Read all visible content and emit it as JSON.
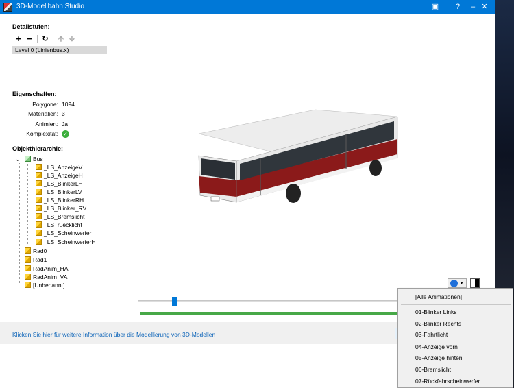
{
  "window": {
    "title": "3D-Modellbahn Studio",
    "controls": [
      "restore-icon",
      "help",
      "minimize",
      "close"
    ]
  },
  "detail": {
    "header": "Detailstufen:",
    "lod_items": [
      "Level 0 (Linienbus.x)"
    ]
  },
  "properties": {
    "header": "Eigenschaften:",
    "rows": [
      {
        "label": "Polygone:",
        "value": "1094"
      },
      {
        "label": "Materialien:",
        "value": "3"
      },
      {
        "label": "Animiert:",
        "value": "Ja"
      },
      {
        "label": "Komplexität:",
        "value": "ok-icon"
      }
    ]
  },
  "hierarchy": {
    "header": "Objekthierarchie:",
    "root": "Bus",
    "children": [
      "_LS_AnzeigeV",
      "_LS_AnzeigeH",
      "_LS_BlinkerLH",
      "_LS_BlinkerLV",
      "_LS_BlinkerRH",
      "_LS_Blinker_RV",
      "_LS_Bremslicht",
      "_LS_ruecklicht",
      "_LS_Scheinwerfer",
      "_LS_ScheinwerferH"
    ],
    "siblings": [
      "Rad0",
      "Rad1",
      "RadAnim_HA",
      "RadAnim_VA",
      "[Unbenannt]"
    ]
  },
  "timeline": {
    "position_fraction": 0.14,
    "progress_fraction": 1.0
  },
  "footer": {
    "link": "Klicken Sie hier für weitere Information über die Modellierung von 3D-Modellen"
  },
  "animation_menu": {
    "items": [
      "[Alle Animationen]",
      "01-Blinker Links",
      "02-Blinker Rechts",
      "03-Fahrtlicht",
      "04-Anzeige vorn",
      "05-Anzeige hinten",
      "06-Bremslicht",
      "07-Rückfahrscheinwerfer"
    ]
  },
  "colors": {
    "titlebar": "#0078d7",
    "bus_red": "#8b1a1a",
    "bus_white": "#f2f2f2",
    "progress": "#47a847"
  }
}
